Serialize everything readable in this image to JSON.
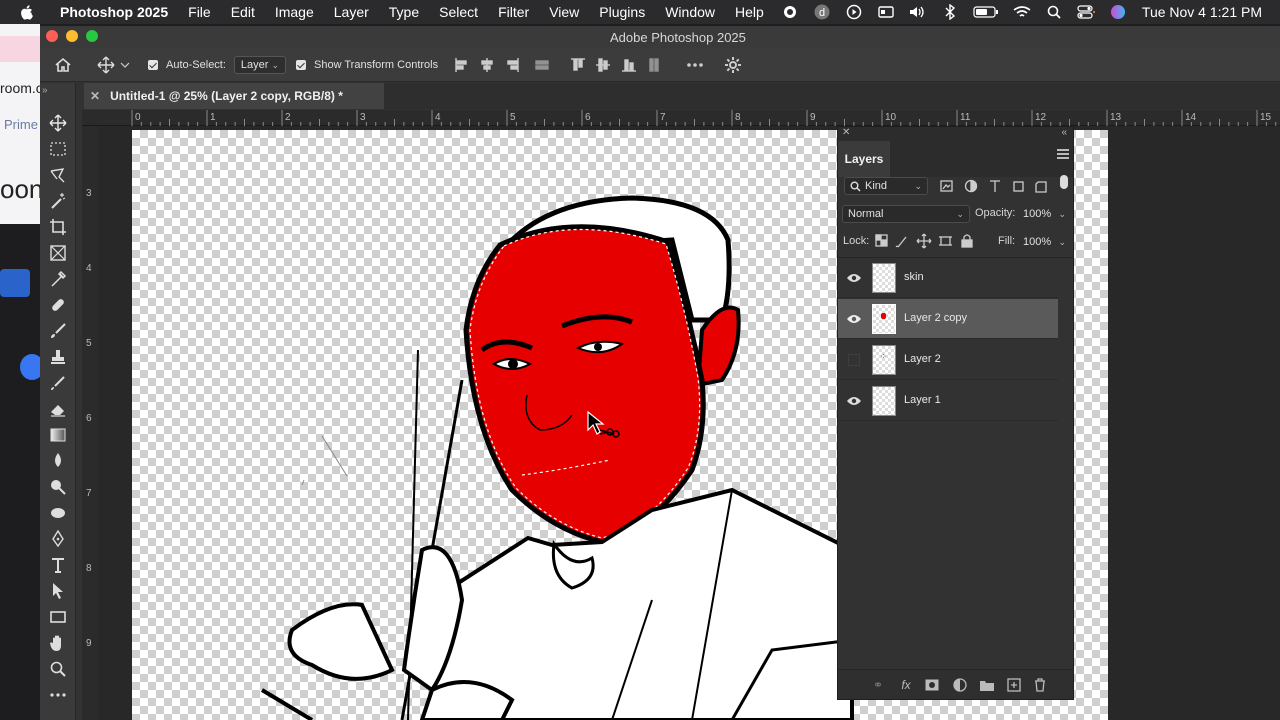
{
  "menubar": {
    "app_name": "Photoshop 2025",
    "items": [
      "File",
      "Edit",
      "Image",
      "Layer",
      "Type",
      "Select",
      "Filter",
      "View",
      "Plugins",
      "Window",
      "Help"
    ],
    "clock": "Tue Nov 4  1:21 PM"
  },
  "bg_window": {
    "text1": "room.c",
    "text2": "Prime",
    "text3": "oon"
  },
  "window": {
    "title": "Adobe Photoshop 2025"
  },
  "options_bar": {
    "auto_select_label": "Auto-Select:",
    "auto_select_value": "Layer",
    "show_transform_label": "Show Transform Controls"
  },
  "document_tab": {
    "title": "Untitled-1 @ 25% (Layer 2 copy, RGB/8) *"
  },
  "ruler": {
    "top_ticks": [
      "0",
      "1",
      "2",
      "3",
      "4",
      "5",
      "6",
      "7",
      "8",
      "9",
      "10",
      "11",
      "12",
      "13",
      "14",
      "15"
    ],
    "left_ticks": [
      "3",
      "4",
      "5",
      "6",
      "7",
      "8",
      "9"
    ]
  },
  "layers_panel": {
    "tab_label": "Layers",
    "filter_kind": "Kind",
    "blend_mode": "Normal",
    "opacity_label": "Opacity:",
    "opacity_value": "100%",
    "lock_label": "Lock:",
    "fill_label": "Fill:",
    "fill_value": "100%",
    "layers": [
      {
        "name": "skin",
        "visible": true,
        "selected": false
      },
      {
        "name": "Layer 2 copy",
        "visible": true,
        "selected": true
      },
      {
        "name": "Layer 2",
        "visible": false,
        "selected": false
      },
      {
        "name": "Layer 1",
        "visible": true,
        "selected": false
      }
    ]
  },
  "colors": {
    "menubar_bg": "#2b2b2e",
    "panel_bg": "#323232",
    "selected_layer": "#5a5a5a",
    "skin_red": "#e60000"
  }
}
